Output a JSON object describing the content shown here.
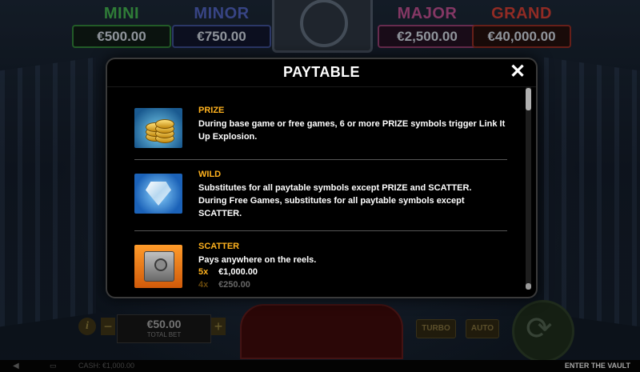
{
  "jackpots": [
    {
      "name": "MINI",
      "value": "€500.00",
      "color": "#3fa64a"
    },
    {
      "name": "MINOR",
      "value": "€750.00",
      "color": "#4a5bb0"
    },
    {
      "name": "MAJOR",
      "value": "€2,500.00",
      "color": "#b04a86"
    },
    {
      "name": "GRAND",
      "value": "€40,000.00",
      "color": "#c23a30"
    }
  ],
  "modal": {
    "title": "PAYTABLE",
    "close_label": "✕",
    "entries": [
      {
        "name": "PRIZE",
        "icon": "gold-coins-symbol-icon",
        "description": "During base game or free games, 6 or more PRIZE symbols trigger Link It Up Explosion."
      },
      {
        "name": "WILD",
        "icon": "diamond-symbol-icon",
        "description_lines": [
          "Substitutes for all paytable symbols except PRIZE and SCATTER.",
          "During Free Games, substitutes for all paytable symbols except SCATTER."
        ]
      },
      {
        "name": "SCATTER",
        "icon": "vault-safe-symbol-icon",
        "description": "Pays anywhere on the reels.",
        "payouts": [
          {
            "count": "5x",
            "amount": "€1,000.00"
          },
          {
            "count": "4x",
            "amount": "€250.00"
          }
        ]
      }
    ],
    "scroll_fraction": 0.0
  },
  "controls": {
    "info_label": "i",
    "minus_label": "−",
    "plus_label": "+",
    "bet_value": "€50.00",
    "bet_label": "TOTAL BET",
    "turbo_label": "TURBO",
    "auto_label": "AUTO"
  },
  "footer": {
    "cash": "CASH: €1,000.00",
    "game_title": "ENTER THE VAULT"
  },
  "colors": {
    "accent": "#ffb21e",
    "modal_bg": "#000000",
    "text": "#ffffff"
  }
}
